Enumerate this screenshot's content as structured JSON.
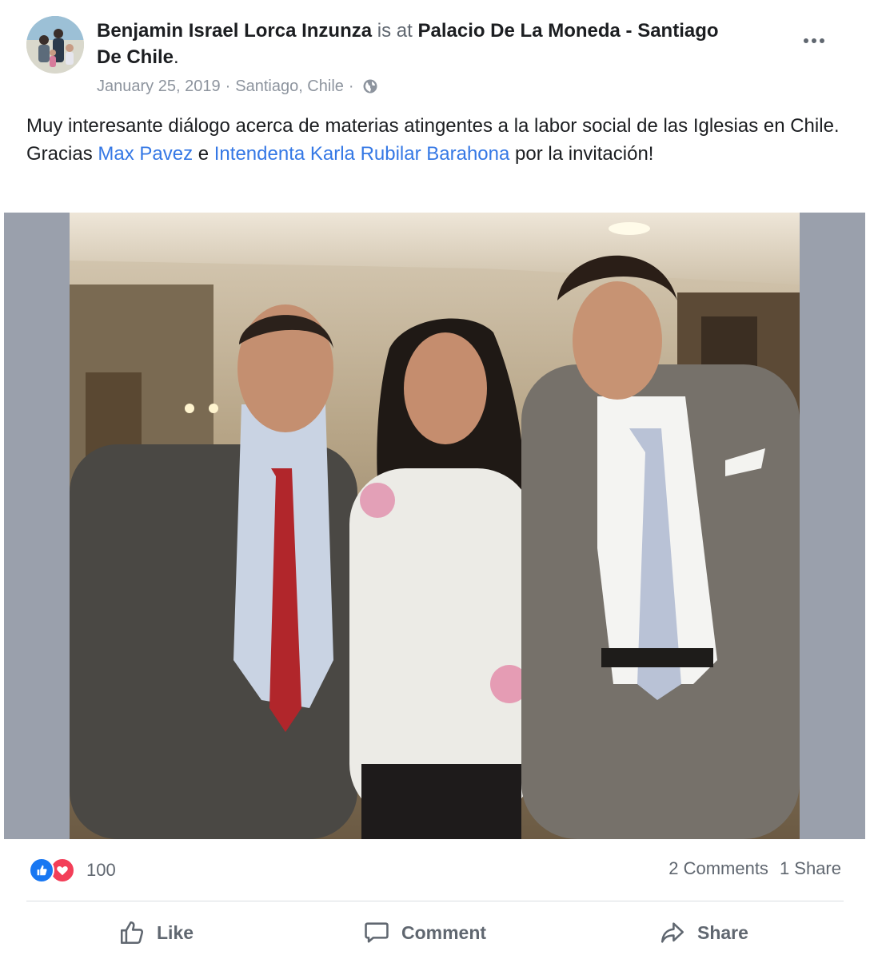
{
  "post": {
    "author": "Benjamin Israel Lorca Inzunza",
    "is_at": "is at",
    "place": "Palacio De La Moneda - Santiago De Chile",
    "place_end": ".",
    "date": "January 25, 2019",
    "separator": "·",
    "location": "Santiago, Chile",
    "privacy_icon": "globe-icon",
    "text_1": "Muy interesante diálogo acerca de materias atingentes a la labor social de las Iglesias en Chile. Gracias ",
    "mention_1": "Max Pavez",
    "text_2": " e ",
    "mention_2": "Intendenta Karla Rubilar Barahona",
    "text_3": " por la invitación!"
  },
  "footer": {
    "reaction_count": "100",
    "comments": "2 Comments",
    "shares": "1 Share",
    "like_label": "Like",
    "comment_label": "Comment",
    "share_label": "Share"
  },
  "colors": {
    "link": "#3578e5",
    "like_blue": "#1877f2",
    "love_red": "#f33e58",
    "muted": "#606770"
  }
}
